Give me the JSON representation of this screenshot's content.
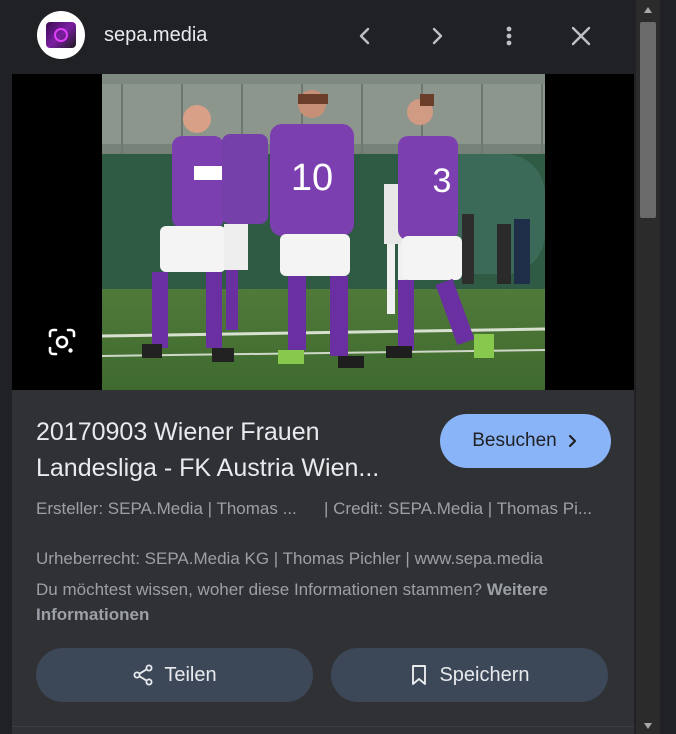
{
  "header": {
    "site_name": "sepa.media",
    "icons": [
      "site-logo",
      "chevron-left-icon",
      "chevron-right-icon",
      "more-vert-icon",
      "close-icon"
    ]
  },
  "image": {
    "jersey_numbers": [
      "10",
      "3"
    ],
    "lens_icon": "google-lens-icon"
  },
  "result": {
    "title": "20170903 Wiener Frauen Landesliga - FK Austria Wien...",
    "visit_label": "Besuchen",
    "creator": "Ersteller: SEPA.Media | Thomas ...",
    "credit": "| Credit: SEPA.Media | Thomas Pi...",
    "copyright": "Urheberrecht: SEPA.Media KG | Thomas Pichler | www.sepa.media",
    "info_text": "Du möchtest wissen, woher diese Informationen stammen?",
    "info_link": "Weitere Informationen"
  },
  "actions": {
    "share_label": "Teilen",
    "save_label": "Speichern"
  },
  "colors": {
    "panel_bg": "#303134",
    "header_bg": "#202124",
    "accent": "#8ab4f8",
    "button_bg": "#3c4858",
    "jersey": "#7b3fb0"
  }
}
